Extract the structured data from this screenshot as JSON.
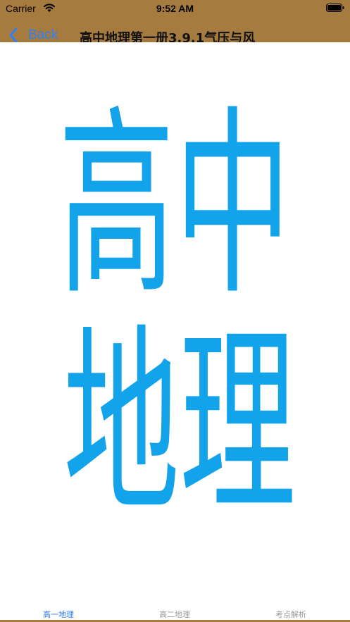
{
  "status_bar": {
    "carrier": "Carrier",
    "time": "9:52 AM",
    "wifi_icon": "wifi-icon",
    "battery_icon": "battery-icon"
  },
  "nav": {
    "back_label": "Back",
    "title": "高中地理第一册3.9.1气压与风"
  },
  "main": {
    "image_text_line1": "高中",
    "image_text_line2": "地理",
    "image_text_color": "#12a3ea"
  },
  "tabs": [
    {
      "label": "高一地理",
      "active": true
    },
    {
      "label": "高二地理",
      "active": false
    },
    {
      "label": "考点解析",
      "active": false
    }
  ],
  "colors": {
    "accent": "#2f7ff5",
    "brand": "#a67b3f"
  }
}
